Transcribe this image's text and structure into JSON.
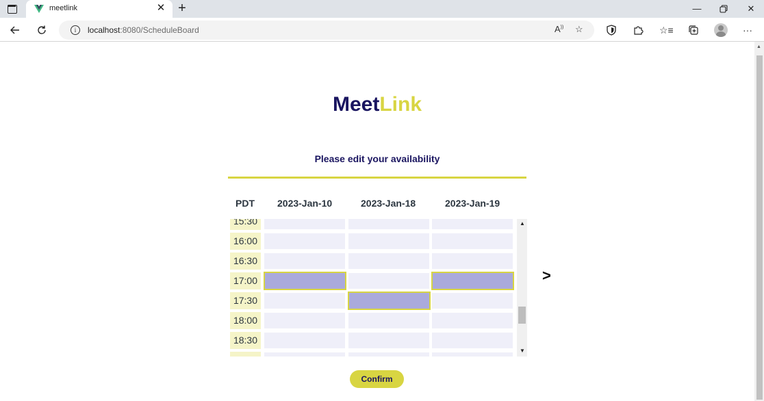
{
  "browser": {
    "tab_title": "meetlink",
    "tab_close": "✕",
    "new_tab": "+",
    "url_host": "localhost",
    "url_rest": ":8080/ScheduleBoard",
    "read_aloud": "A",
    "menu": "···"
  },
  "page": {
    "brand_meet": "Meet",
    "brand_link": "Link",
    "subtitle": "Please edit your availability",
    "timezone": "PDT",
    "dates": [
      "2023-Jan-10",
      "2023-Jan-18",
      "2023-Jan-19"
    ],
    "next": ">",
    "confirm_label": "Confirm"
  },
  "schedule": {
    "rows": [
      {
        "time": "15:30",
        "slots": [
          false,
          false,
          false
        ]
      },
      {
        "time": "16:00",
        "slots": [
          false,
          false,
          false
        ]
      },
      {
        "time": "16:30",
        "slots": [
          false,
          false,
          false
        ]
      },
      {
        "time": "17:00",
        "slots": [
          true,
          false,
          true
        ]
      },
      {
        "time": "17:30",
        "slots": [
          false,
          true,
          false
        ]
      },
      {
        "time": "18:00",
        "slots": [
          false,
          false,
          false
        ]
      },
      {
        "time": "18:30",
        "slots": [
          false,
          false,
          false
        ]
      },
      {
        "time": "",
        "slots": [
          false,
          false,
          false
        ]
      }
    ]
  },
  "colors": {
    "brand_dark": "#1a1560",
    "brand_yellow": "#d8d542",
    "slot_empty": "#efeff9",
    "slot_selected": "#aaaadc",
    "time_bg": "#f5f4c8"
  },
  "icons": [
    "sidebar-icon",
    "vue-favicon-icon",
    "back-icon",
    "refresh-icon",
    "info-icon",
    "read-aloud-icon",
    "favorite-add-icon",
    "shield-icon",
    "extensions-icon",
    "favorites-icon",
    "collections-icon",
    "profile-icon",
    "more-icon"
  ]
}
